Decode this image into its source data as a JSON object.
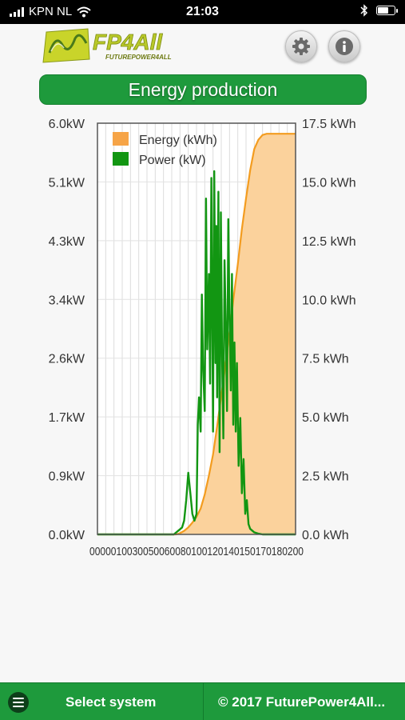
{
  "status_bar": {
    "carrier": "KPN NL",
    "time": "21:03"
  },
  "header": {
    "logo_text": "FP4All",
    "logo_subtext": "FUTUREPOWER4ALL",
    "settings_icon": "gear-icon",
    "info_icon": "info-icon"
  },
  "title": "Energy production",
  "chart_data": {
    "type": "line",
    "title": "",
    "legend": [
      "Energy (kWh)",
      "Power (kW)"
    ],
    "legend_position": "top-left",
    "grid": true,
    "y_left": {
      "ticks": [
        "0.0kW",
        "0.9kW",
        "1.7kW",
        "2.6kW",
        "3.4kW",
        "4.3kW",
        "5.1kW",
        "6.0kW"
      ],
      "range": [
        0,
        6.0
      ]
    },
    "y_right": {
      "ticks": [
        "0.0 kWh",
        "2.5 kWh",
        "5.0 kWh",
        "7.5 kWh",
        "10.0 kWh",
        "12.5 kWh",
        "15.0 kWh",
        "17.5 kWh"
      ],
      "range": [
        0,
        17.5
      ]
    },
    "x_label_text": "0000010030050060080100120140150170180200",
    "x": {
      "range": [
        0,
        48
      ]
    },
    "series": [
      {
        "name": "Energy (kWh)",
        "color": "#f39c1f",
        "fill": "#fbd29c",
        "type": "area",
        "points": [
          [
            0,
            0
          ],
          [
            19,
            0
          ],
          [
            20,
            0.05
          ],
          [
            21,
            0.15
          ],
          [
            22,
            0.3
          ],
          [
            23,
            0.5
          ],
          [
            24,
            0.75
          ],
          [
            25,
            1.1
          ],
          [
            26,
            1.7
          ],
          [
            27,
            2.5
          ],
          [
            28,
            3.4
          ],
          [
            29,
            4.6
          ],
          [
            30,
            5.9
          ],
          [
            31,
            7.2
          ],
          [
            32,
            8.6
          ],
          [
            33,
            10.1
          ],
          [
            34,
            11.5
          ],
          [
            35,
            13.0
          ],
          [
            36,
            14.3
          ],
          [
            37,
            15.5
          ],
          [
            38,
            16.4
          ],
          [
            39,
            16.8
          ],
          [
            40,
            17.0
          ],
          [
            41,
            17.05
          ],
          [
            48,
            17.05
          ]
        ]
      },
      {
        "name": "Power (kW)",
        "color": "#129612",
        "type": "line",
        "points": [
          [
            0,
            0
          ],
          [
            18.5,
            0
          ],
          [
            19.5,
            0.05
          ],
          [
            20.5,
            0.1
          ],
          [
            21,
            0.2
          ],
          [
            21.5,
            0.5
          ],
          [
            22,
            0.9
          ],
          [
            22.5,
            0.6
          ],
          [
            23,
            0.3
          ],
          [
            23.5,
            0.2
          ],
          [
            24,
            0.3
          ],
          [
            24.3,
            1.6
          ],
          [
            24.6,
            2.0
          ],
          [
            25,
            1.5
          ],
          [
            25.3,
            3.5
          ],
          [
            25.6,
            2.4
          ],
          [
            26,
            1.8
          ],
          [
            26.3,
            4.9
          ],
          [
            26.6,
            2.7
          ],
          [
            27,
            3.8
          ],
          [
            27.3,
            2.2
          ],
          [
            27.6,
            5.2
          ],
          [
            28,
            1.5
          ],
          [
            28.3,
            5.3
          ],
          [
            28.6,
            2.5
          ],
          [
            28.8,
            4.5
          ],
          [
            29,
            2.0
          ],
          [
            29.3,
            5.0
          ],
          [
            29.6,
            1.2
          ],
          [
            29.9,
            4.7
          ],
          [
            30.2,
            2.6
          ],
          [
            30.5,
            1.4
          ],
          [
            30.8,
            4.0
          ],
          [
            31.1,
            3.0
          ],
          [
            31.4,
            1.8
          ],
          [
            31.7,
            4.6
          ],
          [
            32,
            3.2
          ],
          [
            32.3,
            2.1
          ],
          [
            32.6,
            3.8
          ],
          [
            32.9,
            1.6
          ],
          [
            33.2,
            2.8
          ],
          [
            33.5,
            1.5
          ],
          [
            33.8,
            2.5
          ],
          [
            34.2,
            1.0
          ],
          [
            34.6,
            1.7
          ],
          [
            35,
            0.6
          ],
          [
            35.4,
            1.1
          ],
          [
            35.8,
            0.3
          ],
          [
            36.2,
            0.5
          ],
          [
            36.6,
            0.15
          ],
          [
            37,
            0.08
          ],
          [
            38,
            0.03
          ],
          [
            39,
            0.01
          ],
          [
            40,
            0
          ],
          [
            48,
            0
          ]
        ]
      }
    ]
  },
  "bottom_bar": {
    "menu_icon": "hamburger-menu-icon",
    "select_system": "Select system",
    "copyright": "© 2017 FuturePower4All..."
  }
}
